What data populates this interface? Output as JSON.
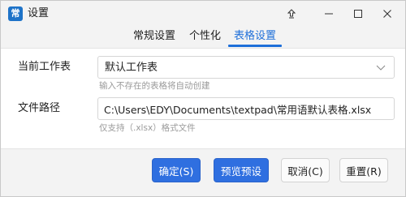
{
  "window": {
    "title": "设置",
    "app_icon": "常",
    "controls": {
      "pin_icon": "pin-icon",
      "minimize_icon": "minimize-icon",
      "maximize_icon": "maximize-icon",
      "close_icon": "close-icon"
    }
  },
  "tabs": [
    {
      "label": "常规设置",
      "active": false
    },
    {
      "label": "个性化",
      "active": false
    },
    {
      "label": "表格设置",
      "active": true
    }
  ],
  "form": {
    "sheet": {
      "label": "当前工作表",
      "value": "默认工作表",
      "hint": "输入不存在的表格将自动创建"
    },
    "path": {
      "label": "文件路径",
      "value": "C:\\Users\\EDY\\Documents\\textpad\\常用语默认表格.xlsx",
      "hint": "仅支持（.xlsx）格式文件"
    }
  },
  "buttons": {
    "ok": "确定(S)",
    "preview": "预览预设",
    "cancel": "取消(C)",
    "reset": "重置(R)"
  },
  "colors": {
    "accent": "#1e6fd9",
    "primary_button": "#2f6fe0",
    "hint_text": "#9a9a9a"
  }
}
